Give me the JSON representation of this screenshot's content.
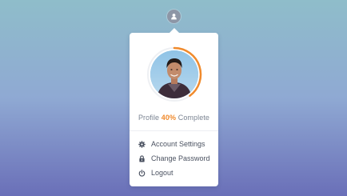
{
  "trigger": {
    "icon": "user-icon"
  },
  "profile": {
    "avatar_icon": "profile-photo",
    "progress_fraction": 0.4,
    "progress_color": "#f08a2c",
    "progress_prefix": "Profile",
    "progress_value": "40%",
    "progress_suffix": "Complete"
  },
  "menu": {
    "items": [
      {
        "label": "Account Settings",
        "icon": "gear-icon"
      },
      {
        "label": "Change Password",
        "icon": "lock-icon"
      },
      {
        "label": "Logout",
        "icon": "power-icon"
      }
    ]
  }
}
